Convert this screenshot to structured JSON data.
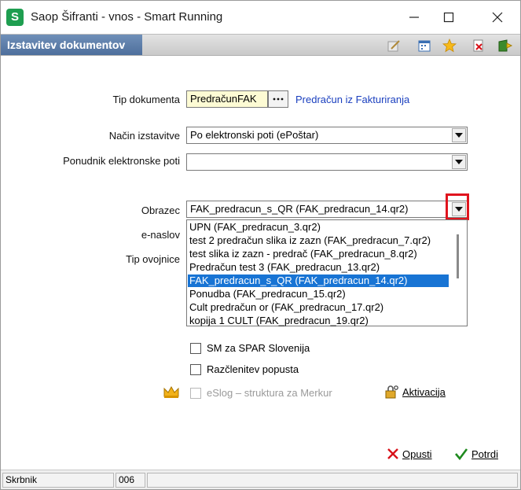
{
  "window": {
    "title": "Saop Šifranti - vnos - Smart Running",
    "app_icon": "S"
  },
  "header": {
    "title": "Izstavitev dokumentov"
  },
  "form": {
    "tip_dokumenta_label": "Tip dokumenta",
    "tip_dokumenta_value": "PredračunFAK",
    "tip_dokumenta_desc": "Predračun iz Fakturiranja",
    "nacin_label": "Način izstavitve",
    "nacin_value": "Po elektronski poti (ePoštar)",
    "ponudnik_label": "Ponudnik elektronske poti",
    "ponudnik_value": "",
    "obrazec_label": "Obrazec",
    "obrazec_value": "FAK_predracun_s_QR (FAK_predracun_14.qr2)",
    "enaslov_label": "e-naslov",
    "tip_ovojnice_label": "Tip ovojnice"
  },
  "dropdown_items": [
    "UPN (FAK_predracun_3.qr2)",
    "test 2 predračun slika iz zazn (FAK_predracun_7.qr2)",
    "test slika iz zazn - predrač (FAK_predracun_8.qr2)",
    "Predračun test 3 (FAK_predracun_13.qr2)",
    "FAK_predracun_s_QR (FAK_predracun_14.qr2)",
    "Ponudba (FAK_predracun_15.qr2)",
    "Cult predračun or (FAK_predracun_17.qr2)",
    "kopija 1 CULT (FAK_predracun_19.qr2)"
  ],
  "selected_index": 4,
  "checkboxes": {
    "sm_spar": "SM za SPAR Slovenija",
    "razclenitev": "Razčlenitev popusta",
    "eslog": "eSlog – struktura za Merkur"
  },
  "buttons": {
    "aktivacija": "Aktivacija",
    "opusti": "Opusti",
    "potrdi": "Potrdi"
  },
  "statusbar": {
    "user": "Skrbnik",
    "code": "006"
  },
  "colors": {
    "selection": "#1874d4",
    "link": "#1a3fbf",
    "highlight": "#e0141e"
  }
}
